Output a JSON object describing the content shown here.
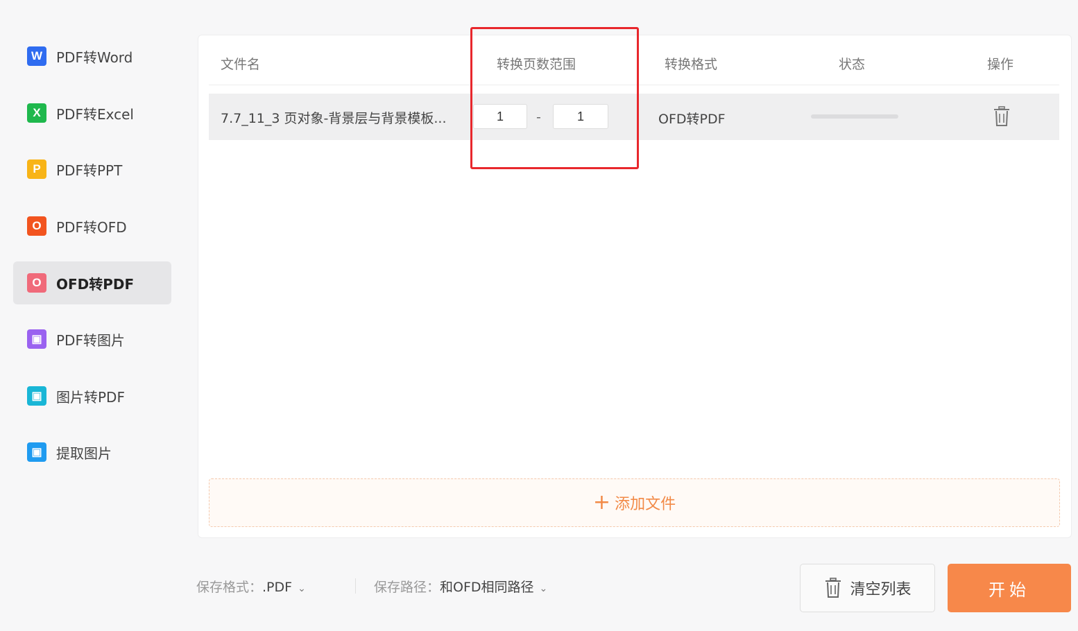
{
  "sidebar": {
    "items": [
      {
        "label": "PDF转Word",
        "icon": "W",
        "icon_name": "word-icon",
        "color": "#2f6cf0"
      },
      {
        "label": "PDF转Excel",
        "icon": "X",
        "icon_name": "excel-icon",
        "color": "#1fb84d"
      },
      {
        "label": "PDF转PPT",
        "icon": "P",
        "icon_name": "ppt-icon",
        "color": "#f8b417"
      },
      {
        "label": "PDF转OFD",
        "icon": "O",
        "icon_name": "ofd-icon",
        "color": "#f2541f"
      },
      {
        "label": "OFD转PDF",
        "icon": "O",
        "icon_name": "ofd-to-pdf-icon",
        "color": "#f06a7a",
        "active": true
      },
      {
        "label": "PDF转图片",
        "icon": "▣",
        "icon_name": "pdf-to-image-icon",
        "color": "#9a62f0"
      },
      {
        "label": "图片转PDF",
        "icon": "▣",
        "icon_name": "image-to-pdf-icon",
        "color": "#19b6d6"
      },
      {
        "label": "提取图片",
        "icon": "▣",
        "icon_name": "extract-image-icon",
        "color": "#1f9bf0"
      }
    ]
  },
  "table": {
    "headers": {
      "filename": "文件名",
      "page_range": "转换页数范围",
      "format": "转换格式",
      "status": "状态",
      "action": "操作"
    },
    "rows": [
      {
        "filename": "7.7_11_3 页对象-背景层与背景模板...",
        "page_from": "1",
        "separator": "-",
        "page_to": "1",
        "format": "OFD转PDF",
        "progress": 0
      }
    ]
  },
  "add_files": {
    "plus": "+",
    "label": "添加文件"
  },
  "bottom": {
    "save_format_label": "保存格式：",
    "save_format_value": ".PDF",
    "save_path_label": "保存路径：",
    "save_path_value": "和OFD相同路径",
    "clear_label": "清空列表",
    "start_label": "开始"
  },
  "colors": {
    "accent": "#f7884a",
    "highlight": "#e8272c"
  }
}
